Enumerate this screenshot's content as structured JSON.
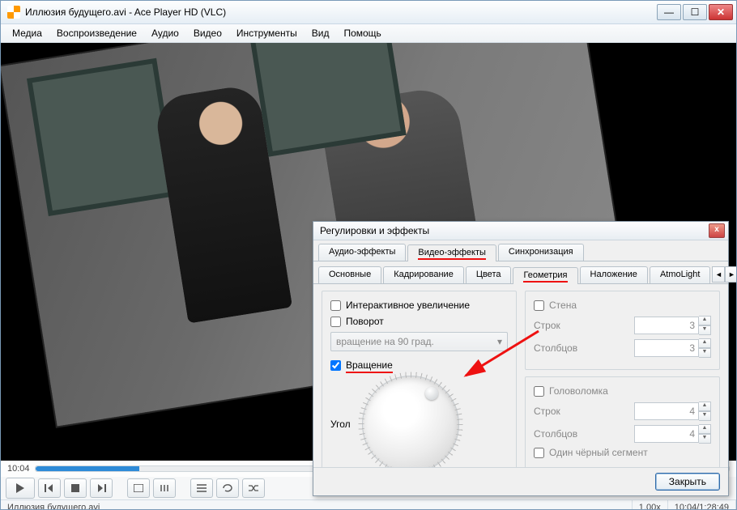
{
  "window": {
    "title": "Иллюзия будущего.avi - Ace Player HD (VLC)"
  },
  "menu": [
    "Медиа",
    "Воспроизведение",
    "Аудио",
    "Видео",
    "Инструменты",
    "Вид",
    "Помощь"
  ],
  "seek": {
    "elapsed": "10:04"
  },
  "status": {
    "file": "Иллюзия будущего.avi",
    "speed": "1.00x",
    "time": "10:04/1:28:49"
  },
  "dialog": {
    "title": "Регулировки и эффекты",
    "tabs": [
      "Аудио-эффекты",
      "Видео-эффекты",
      "Синхронизация"
    ],
    "active_tab": 1,
    "subtabs": [
      "Основные",
      "Кадрирование",
      "Цвета",
      "Геометрия",
      "Наложение",
      "AtmoLight"
    ],
    "active_subtab": 3,
    "zoom_label": "Интерактивное увеличение",
    "rotate_chk": "Поворот",
    "rotate_combo": "вращение на 90 град.",
    "rotation_chk": "Вращение",
    "angle_label": "Угол",
    "wall": {
      "title": "Стена",
      "rows_label": "Строк",
      "rows": "3",
      "cols_label": "Столбцов",
      "cols": "3"
    },
    "puzzle": {
      "title": "Головоломка",
      "rows_label": "Строк",
      "rows": "4",
      "cols_label": "Столбцов",
      "cols": "4",
      "black": "Один чёрный сегмент"
    },
    "close": "Закрыть"
  }
}
